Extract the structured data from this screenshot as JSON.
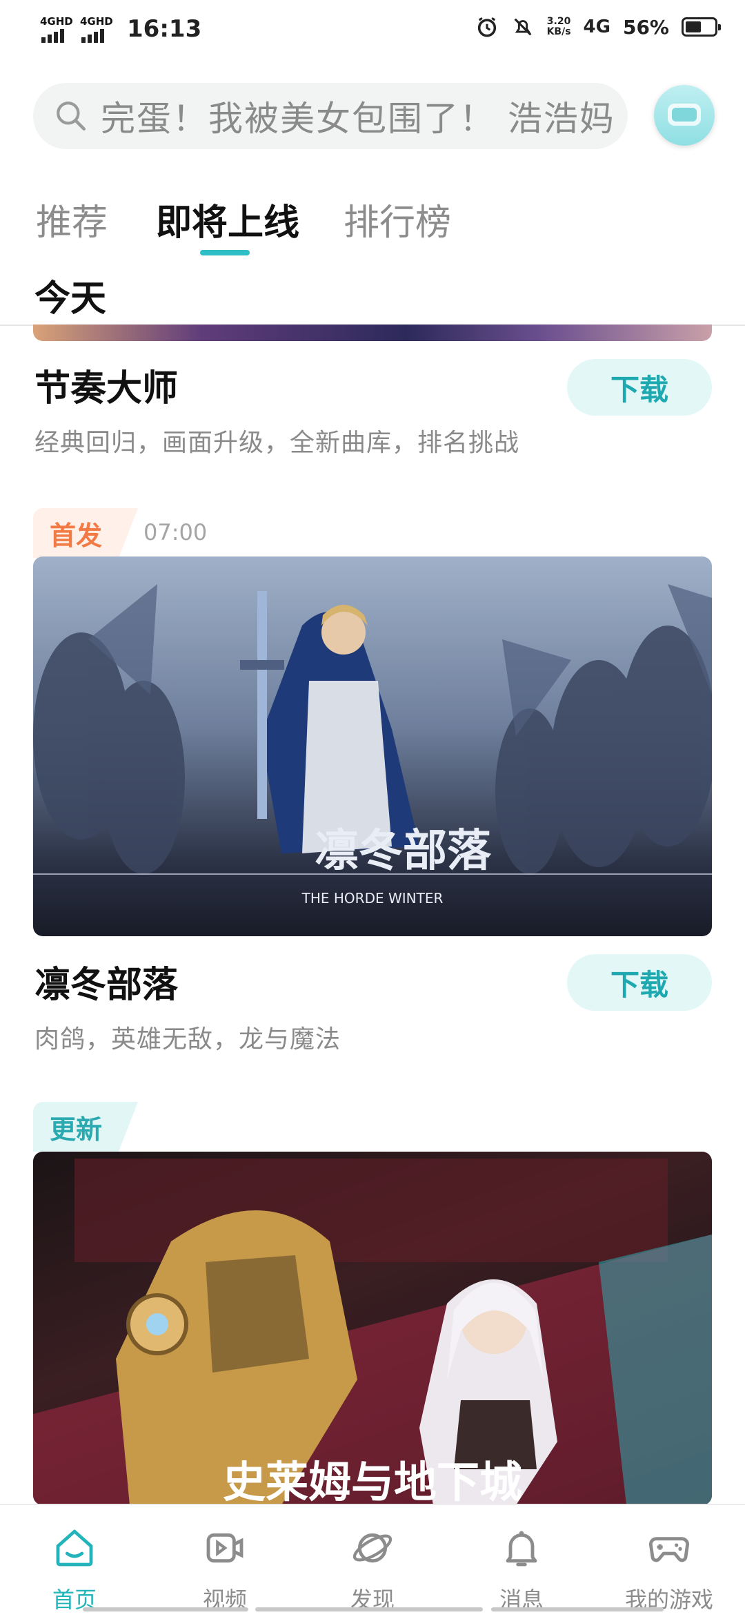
{
  "status_bar": {
    "signal1": "4GHD",
    "signal2": "4GHD",
    "time": "16:13",
    "speed_value": "3.20",
    "speed_unit": "KB/s",
    "network": "4G",
    "battery": "56%",
    "battery_level": 0.56
  },
  "search": {
    "placeholder": "完蛋！我被美女包围了！ 浩浩妈"
  },
  "tabs": [
    {
      "label": "推荐",
      "active": false
    },
    {
      "label": "即将上线",
      "active": true
    },
    {
      "label": "排行榜",
      "active": false
    }
  ],
  "section": {
    "header": "今天"
  },
  "games": [
    {
      "title": "节奏大师",
      "description": "经典回归，画面升级，全新曲库，排名挑战",
      "download_label": "下载"
    },
    {
      "tag": "首发",
      "time": "07:00",
      "title": "凛冬部落",
      "description": "肉鸽，英雄无敌，龙与魔法",
      "download_label": "下载",
      "banner_logo": "凛冬部落",
      "banner_subtitle": "THE HORDE WINTER"
    },
    {
      "tag": "更新",
      "banner_logo": "史莱姆与地下城"
    }
  ],
  "bottom_nav": [
    {
      "label": "首页",
      "icon": "home-icon",
      "active": true
    },
    {
      "label": "视频",
      "icon": "video-icon",
      "active": false
    },
    {
      "label": "发现",
      "icon": "discover-icon",
      "active": false
    },
    {
      "label": "消息",
      "icon": "bell-icon",
      "active": false
    },
    {
      "label": "我的游戏",
      "icon": "gamepad-icon",
      "active": false
    }
  ],
  "colors": {
    "accent": "#22b3bb",
    "tag_orange": "#f27a45"
  }
}
